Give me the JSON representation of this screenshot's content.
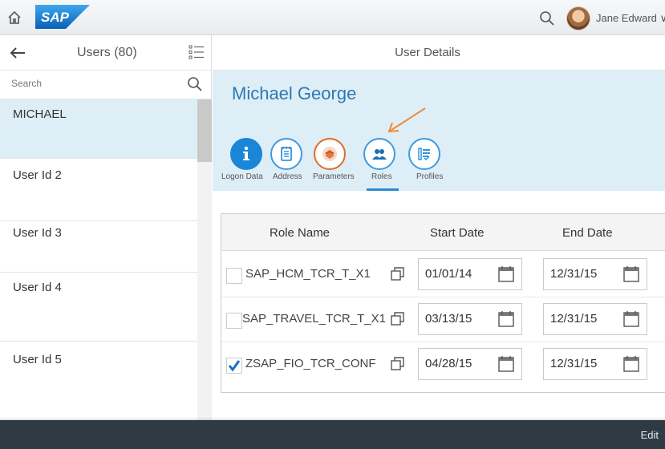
{
  "shell": {
    "logo_text": "SAP",
    "user_name": "Jane Edward ∨"
  },
  "master": {
    "title": "Users (80)",
    "search_placeholder": "Search",
    "items": [
      {
        "label": "MICHAEL",
        "selected": true
      },
      {
        "label": "User Id 2"
      },
      {
        "label": "User Id 3"
      },
      {
        "label": "User Id 4"
      },
      {
        "label": "User Id 5"
      }
    ]
  },
  "detail": {
    "title": "User Details",
    "person_name": "Michael George",
    "tabs": [
      {
        "label": "Logon Data",
        "icon": "info-icon",
        "color": "#1b86d8"
      },
      {
        "label": "Address",
        "icon": "address-card-icon",
        "color": "#3e9be0"
      },
      {
        "label": "Parameters",
        "icon": "parameters-icon",
        "color": "#e06c2a"
      },
      {
        "label": "Roles",
        "icon": "roles-icon",
        "color": "#3e9be0",
        "selected": true
      },
      {
        "label": "Profiles",
        "icon": "profiles-icon",
        "color": "#3e9be0"
      }
    ],
    "table": {
      "headers": [
        "Role Name",
        "Start Date",
        "End Date"
      ],
      "rows": [
        {
          "checked": false,
          "role": "SAP_HCM_TCR_T_X1",
          "start": "01/01/14",
          "end": "12/31/15"
        },
        {
          "checked": false,
          "role": "SAP_TRAVEL_TCR_T_X1",
          "start": "03/13/15",
          "end": "12/31/15"
        },
        {
          "checked": true,
          "role": "ZSAP_FIO_TCR_CONF",
          "start": "04/28/15",
          "end": "12/31/15"
        }
      ]
    }
  },
  "footer": {
    "edit_label": "Edit"
  },
  "colors": {
    "accent": "#2d79b3",
    "header_bg": "#deeef7",
    "footer_bg": "#2f3b44",
    "annotation_arrow": "#f08a3c"
  }
}
